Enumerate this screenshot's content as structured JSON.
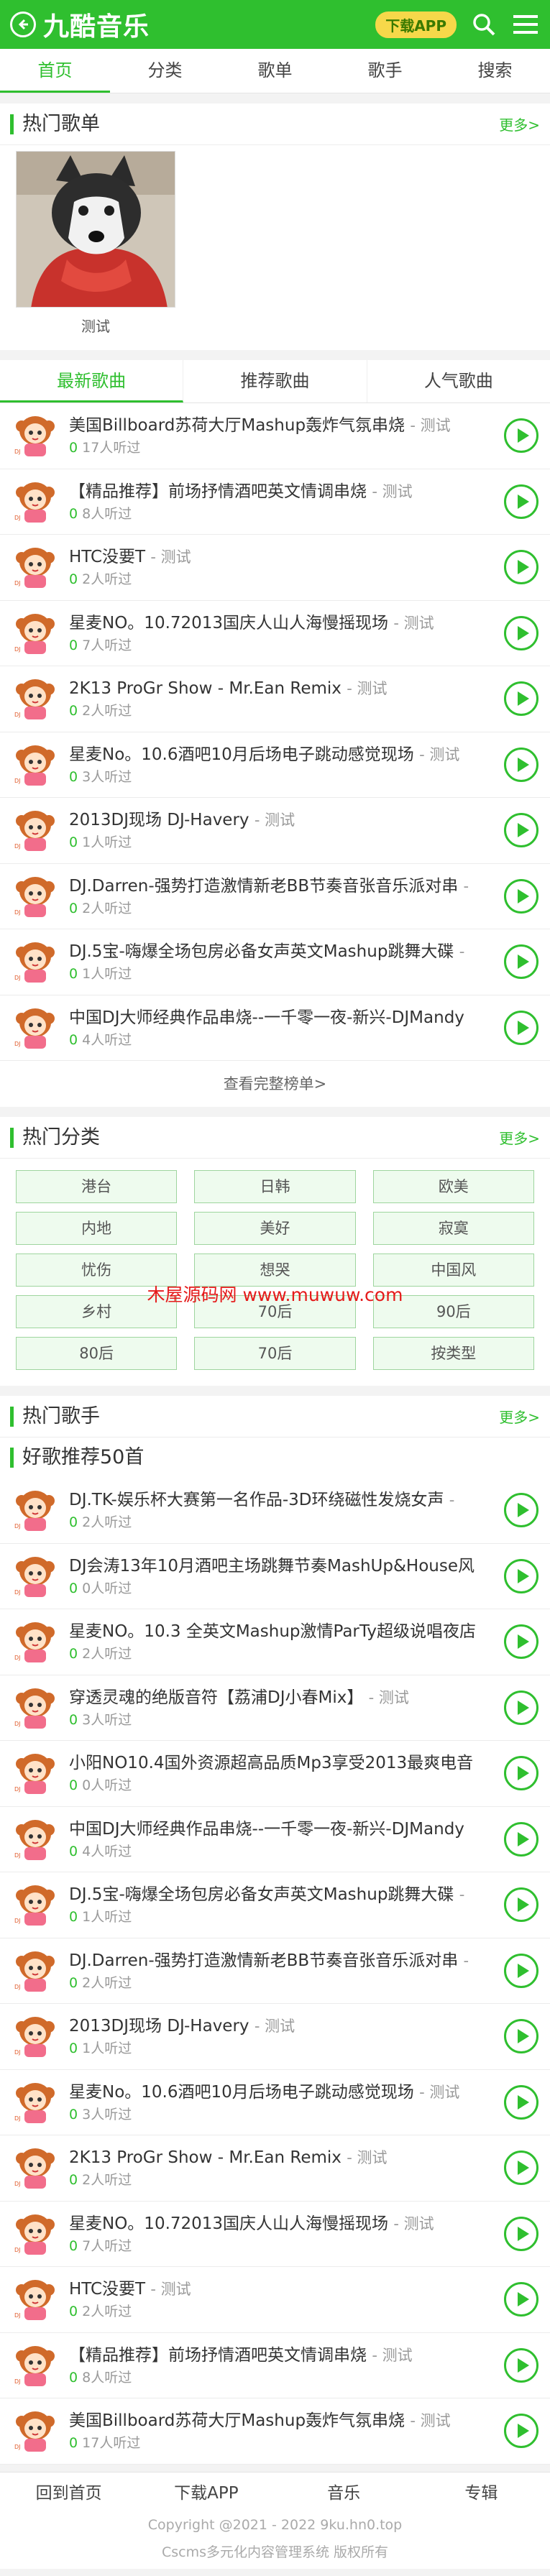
{
  "header": {
    "logo": "九酷音乐",
    "download_label": "下载APP",
    "icons": [
      "back-icon",
      "search-icon",
      "menu-icon"
    ]
  },
  "nav": [
    "首页",
    "分类",
    "歌单",
    "歌手",
    "搜索"
  ],
  "hot_playlists": {
    "title": "热门歌单",
    "more": "更多>",
    "items": [
      {
        "name": "测试"
      }
    ]
  },
  "song_tabs": [
    "最新歌曲",
    "推荐歌曲",
    "人气歌曲"
  ],
  "latest_songs": [
    {
      "title": "美国Billboard苏荷大厅Mashup轰炸气氛串烧",
      "artist": "- 测试",
      "count": "0",
      "suffix": "17人听过"
    },
    {
      "title": "【精品推荐】前场抒情酒吧英文情调串烧",
      "artist": "- 测试",
      "count": "0",
      "suffix": "8人听过"
    },
    {
      "title": "HTC没要T",
      "artist": "- 测试",
      "count": "0",
      "suffix": "2人听过"
    },
    {
      "title": "星麦NO。10.72013国庆人山人海慢摇现场",
      "artist": "- 测试",
      "count": "0",
      "suffix": "7人听过"
    },
    {
      "title": "2K13 ProGr Show - Mr.Ean Remix",
      "artist": "- 测试",
      "count": "0",
      "suffix": "2人听过"
    },
    {
      "title": "星麦No。10.6酒吧10月后场电子跳动感觉现场",
      "artist": "- 测试",
      "count": "0",
      "suffix": "3人听过"
    },
    {
      "title": "2013DJ现场 DJ-Havery",
      "artist": "- 测试",
      "count": "0",
      "suffix": "1人听过"
    },
    {
      "title": "DJ.Darren-强势打造激情新老BB节奏音张音乐派对串",
      "artist": "-",
      "count": "0",
      "suffix": "2人听过"
    },
    {
      "title": "DJ.5宝-嗨爆全场包房必备女声英文Mashup跳舞大碟",
      "artist": "-",
      "count": "0",
      "suffix": "1人听过"
    },
    {
      "title": "中国DJ大师经典作品串烧--一千零一夜-新兴-DJMandy",
      "artist": "",
      "count": "0",
      "suffix": "4人听过"
    }
  ],
  "view_full_chart": "查看完整榜单>",
  "hot_categories": {
    "title": "热门分类",
    "more": "更多>",
    "items": [
      "港台",
      "日韩",
      "欧美",
      "内地",
      "美好",
      "寂寞",
      "忧伤",
      "想哭",
      "中国风",
      "乡村",
      "70后",
      "90后",
      "80后",
      "70后",
      "按类型"
    ],
    "watermark": "木屋源码网 www.muwuw.com"
  },
  "hot_singers": {
    "title": "热门歌手",
    "more": "更多>"
  },
  "recommend": {
    "title": "好歌推荐50首",
    "songs": [
      {
        "title": "DJ.TK-娱乐杯大赛第一名作品-3D环绕磁性发烧女声",
        "artist": "-",
        "count": "0",
        "suffix": "2人听过"
      },
      {
        "title": "DJ会涛13年10月酒吧主场跳舞节奏MashUp&House风",
        "artist": "",
        "count": "0",
        "suffix": "0人听过"
      },
      {
        "title": "星麦NO。10.3 全英文Mashup激情ParTy超级说唱夜店",
        "artist": "",
        "count": "0",
        "suffix": "2人听过"
      },
      {
        "title": "穿透灵魂的绝版音符【荔浦DJ小春Mix】",
        "artist": "- 测试",
        "count": "0",
        "suffix": "3人听过"
      },
      {
        "title": "小阳NO10.4国外资源超高品质Mp3享受2013最爽电音",
        "artist": "",
        "count": "0",
        "suffix": "0人听过"
      },
      {
        "title": "中国DJ大师经典作品串烧--一千零一夜-新兴-DJMandy",
        "artist": "",
        "count": "0",
        "suffix": "4人听过"
      },
      {
        "title": "DJ.5宝-嗨爆全场包房必备女声英文Mashup跳舞大碟",
        "artist": "-",
        "count": "0",
        "suffix": "1人听过"
      },
      {
        "title": "DJ.Darren-强势打造激情新老BB节奏音张音乐派对串",
        "artist": "-",
        "count": "0",
        "suffix": "2人听过"
      },
      {
        "title": "2013DJ现场 DJ-Havery",
        "artist": "- 测试",
        "count": "0",
        "suffix": "1人听过"
      },
      {
        "title": "星麦No。10.6酒吧10月后场电子跳动感觉现场",
        "artist": "- 测试",
        "count": "0",
        "suffix": "3人听过"
      },
      {
        "title": "2K13 ProGr Show - Mr.Ean Remix",
        "artist": "- 测试",
        "count": "0",
        "suffix": "2人听过"
      },
      {
        "title": "星麦NO。10.72013国庆人山人海慢摇现场",
        "artist": "- 测试",
        "count": "0",
        "suffix": "7人听过"
      },
      {
        "title": "HTC没要T",
        "artist": "- 测试",
        "count": "0",
        "suffix": "2人听过"
      },
      {
        "title": "【精品推荐】前场抒情酒吧英文情调串烧",
        "artist": "- 测试",
        "count": "0",
        "suffix": "8人听过"
      },
      {
        "title": "美国Billboard苏荷大厅Mashup轰炸气氛串烧",
        "artist": "- 测试",
        "count": "0",
        "suffix": "17人听过"
      }
    ]
  },
  "footer": {
    "nav": [
      "回到首页",
      "下载APP",
      "音乐",
      "专辑"
    ],
    "copyright": "Copyright @2021 - 2022 9ku.hn0.top",
    "powered": "Cscms多元化内容管理系统 版权所有"
  },
  "colors": {
    "accent": "#2fbf2f",
    "watermark": "#e51b1b",
    "background": "#f3f3f3"
  }
}
